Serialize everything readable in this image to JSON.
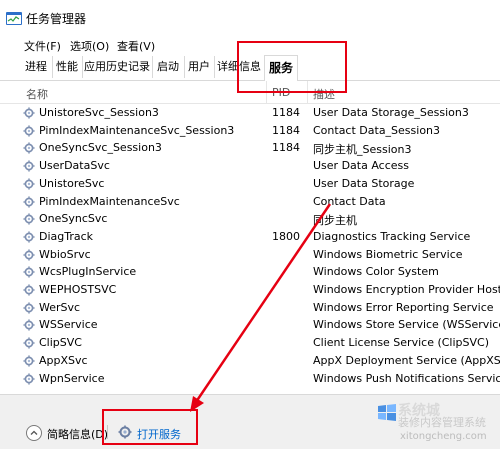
{
  "window": {
    "title": "任务管理器"
  },
  "menu": [
    "文件(F)",
    "选项(O)",
    "查看(V)"
  ],
  "tabs": [
    "进程",
    "性能",
    "应用历史记录",
    "启动",
    "用户",
    "详细信息",
    "服务"
  ],
  "active_tab": "服务",
  "columns": {
    "name": "名称",
    "pid": "PID",
    "desc": "描述"
  },
  "rows": [
    {
      "name": "UnistoreSvc_Session3",
      "pid": "1184",
      "desc": "User Data Storage_Session3"
    },
    {
      "name": "PimIndexMaintenanceSvc_Session3",
      "pid": "1184",
      "desc": "Contact Data_Session3"
    },
    {
      "name": "OneSyncSvc_Session3",
      "pid": "1184",
      "desc": "同步主机_Session3"
    },
    {
      "name": "UserDataSvc",
      "pid": "",
      "desc": "User Data Access"
    },
    {
      "name": "UnistoreSvc",
      "pid": "",
      "desc": "User Data Storage"
    },
    {
      "name": "PimIndexMaintenanceSvc",
      "pid": "",
      "desc": "Contact Data"
    },
    {
      "name": "OneSyncSvc",
      "pid": "",
      "desc": "同步主机"
    },
    {
      "name": "DiagTrack",
      "pid": "1800",
      "desc": "Diagnostics Tracking Service"
    },
    {
      "name": "WbioSrvc",
      "pid": "",
      "desc": "Windows Biometric Service"
    },
    {
      "name": "WcsPlugInService",
      "pid": "",
      "desc": "Windows Color System"
    },
    {
      "name": "WEPHOSTSVC",
      "pid": "",
      "desc": "Windows Encryption Provider Host Se"
    },
    {
      "name": "WerSvc",
      "pid": "",
      "desc": "Windows Error Reporting Service"
    },
    {
      "name": "WSService",
      "pid": "",
      "desc": "Windows Store Service (WSService)"
    },
    {
      "name": "ClipSVC",
      "pid": "",
      "desc": "Client License Service (ClipSVC)"
    },
    {
      "name": "AppXSvc",
      "pid": "",
      "desc": "AppX Deployment Service (AppXSVC)"
    },
    {
      "name": "WpnService",
      "pid": "",
      "desc": "Windows Push Notifications Service"
    }
  ],
  "footer": {
    "brief_label": "简略信息(D)",
    "open_services": "打开服务"
  },
  "watermark": {
    "line1": "系统城",
    "line2": "装修内容管理系统",
    "line3": "xitongcheng.com"
  },
  "colors": {
    "highlight": "#e60012",
    "link": "#0066cc",
    "icon_blue": "#2c70c9"
  }
}
